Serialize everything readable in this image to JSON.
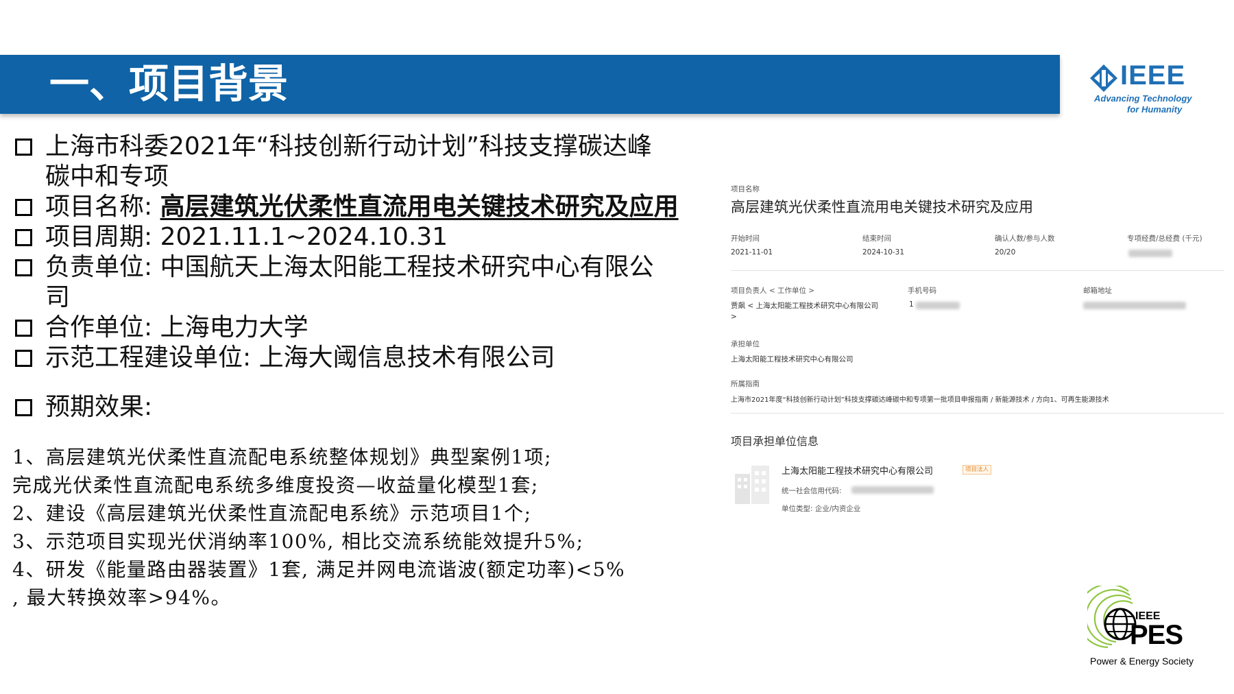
{
  "header": {
    "title": "一、项目背景"
  },
  "ieee_logo": {
    "word": "IEEE",
    "tagline_1": "Advancing Technology",
    "tagline_2": "for Humanity",
    "color": "#1f6fb5"
  },
  "bullets": {
    "b1_line1": "上海市科委2021年“科技创新行动计划”科技支撑碳达峰",
    "b1_line2": "碳中和专项",
    "b2_label": "项目名称: ",
    "b2_value": "高层建筑光伏柔性直流用电关键技术研究及应用",
    "b3": "项目周期: 2021.11.1~2024.10.31",
    "b4_line1": "负责单位: 中国航天上海太阳能工程技术研究中心有限公",
    "b4_line2": "司",
    "b5": "合作单位: 上海电力大学",
    "b6": "示范工程建设单位: 上海大阈信息技术有限公司",
    "b7": "预期效果:"
  },
  "effects": [
    "1、高层建筑光伏柔性直流配电系统整体规划》典型案例1项;",
    "完成光伏柔性直流配电系统多维度投资—收益量化模型1套;",
    "2、建设《高层建筑光伏柔性直流配电系统》示范项目1个;",
    "3、示范项目实现光伏消纳率100%, 相比交流系统能效提升5%;",
    "4、研发《能量路由器装置》1套, 满足并网电流谐波(额定功率)<5%",
    ", 最大转换效率>94%。"
  ],
  "panel": {
    "name_label": "项目名称",
    "name_value": "高层建筑光伏柔性直流用电关键技术研究及应用",
    "start_label": "开始时间",
    "start_value": "2021-11-01",
    "end_label": "结束时间",
    "end_value": "2024-10-31",
    "people_label": "确认人数/参与人数",
    "people_value": "20/20",
    "fund_label": "专项经费/总经费 (千元)",
    "leader_label": "项目负责人 < 工作单位 >",
    "leader_value": "贾飙 < 上海太阳能工程技术研究中心有限公司",
    "leader_value_2": ">",
    "phone_label": "手机号码",
    "phone_prefix": "1",
    "email_label": "邮箱地址",
    "unit_label": "承担单位",
    "unit_value": "上海太阳能工程技术研究中心有限公司",
    "guide_label": "所属指南",
    "guide_value": "上海市2021年度“科技创新行动计划”科技支撑碳达峰碳中和专项第一批项目申报指南 / 新能源技术 / 方向1、可再生能源技术",
    "info_title": "项目承担单位信息",
    "company": "上海太阳能工程技术研究中心有限公司",
    "badge": "项目法人",
    "credit_label": "统一社会信用代码:",
    "type_label": "单位类型: 企业/内资企业"
  },
  "pes_logo": {
    "ieee": "IEEE",
    "word": "PES",
    "tagline": "Power & Energy Society",
    "color": "#8dc63f"
  }
}
